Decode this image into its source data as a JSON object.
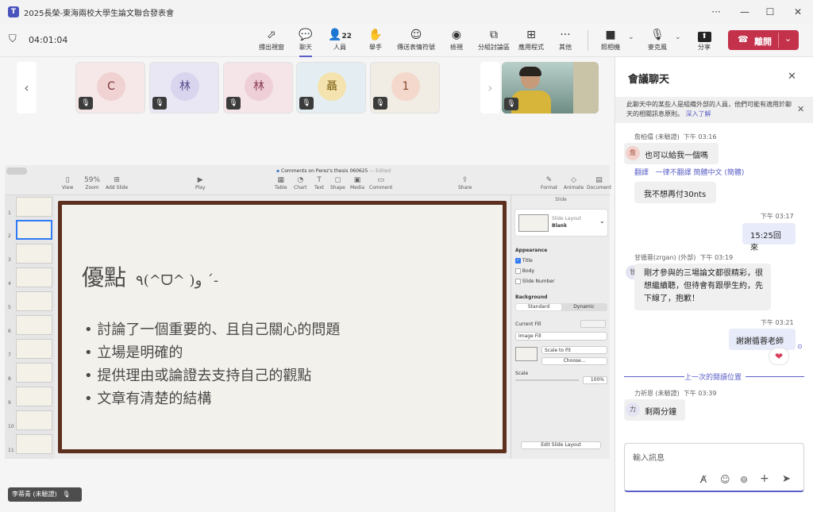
{
  "window": {
    "title": "2025長榮-東海兩校大學生論文聯合發表會",
    "more": "···",
    "minimize": "—",
    "maximize": "☐",
    "close": "✕"
  },
  "meeting": {
    "timer": "04:01:04"
  },
  "toolbar": {
    "items": [
      {
        "label": "撐出視窗",
        "icon": "⬀"
      },
      {
        "label": "聊天",
        "icon": "💬"
      },
      {
        "label": "人員",
        "icon": "👤",
        "count": "22"
      },
      {
        "label": "舉手",
        "icon": "✋"
      },
      {
        "label": "傳送表情符號",
        "icon": "☺"
      },
      {
        "label": "檢視",
        "icon": "◉"
      },
      {
        "label": "分組討論區",
        "icon": "⧉"
      },
      {
        "label": "應用程式",
        "icon": "⊞"
      },
      {
        "label": "其他",
        "icon": "···"
      },
      {
        "label": "照相機",
        "icon": "■"
      },
      {
        "label": "麥克風",
        "icon": "🎙"
      },
      {
        "label": "分享",
        "icon": "⬆"
      }
    ],
    "leave_label": "離開",
    "leave_color": "#c4314b"
  },
  "participants": [
    {
      "initial": "C",
      "bg": "#f5e3e3",
      "avbg": "#f1cfcf",
      "color": "#8a3a3a"
    },
    {
      "initial": "林",
      "bg": "#e6e4f3",
      "avbg": "#d7d3ee",
      "color": "#5a4d8e"
    },
    {
      "initial": "林",
      "bg": "#f4e2e6",
      "avbg": "#efcdd6",
      "color": "#8a3a52"
    },
    {
      "initial": "聶",
      "bg": "#e3eef2",
      "avbg": "#f4e2ad",
      "color": "#7a5c10"
    },
    {
      "initial": "1",
      "bg": "#f3ece3",
      "avbg": "#f3d6c9",
      "color": "#8a4a30"
    }
  ],
  "keynote": {
    "doc_title": "Comments on Perez's thesis 060625",
    "doc_status": "— Edited",
    "zoom": "59%",
    "tools_left": [
      "View",
      "Zoom",
      "Add Slide"
    ],
    "play": "Play",
    "tools_mid": [
      "Table",
      "Chart",
      "Text",
      "Shape",
      "Media",
      "Comment"
    ],
    "share": "Share",
    "tools_right": [
      "Format",
      "Animate",
      "Document"
    ],
    "slide_numbers": [
      "1",
      "2",
      "3",
      "4",
      "5",
      "6",
      "7",
      "8",
      "9",
      "10",
      "11"
    ],
    "slide": {
      "heading": "優點",
      "emoticon": "٩(^ᗜ^ )و ´-",
      "bullets": [
        "討論了一個重要的、且自己關心的問題",
        "立場是明確的",
        "提供理由或論證去支持自己的觀點",
        "文章有清楚的結構"
      ]
    },
    "inspector": {
      "header": "Slide",
      "layout_label": "Slide Layout",
      "layout_value": "Blank",
      "appearance": "Appearance",
      "opt_title": "Title",
      "opt_body": "Body",
      "opt_slide_number": "Slide Number",
      "background": "Background",
      "seg_standard": "Standard",
      "seg_dynamic": "Dynamic",
      "current_fill": "Current Fill",
      "fill_type": "Image Fill",
      "scale_to_fit": "Scale to Fit",
      "choose": "Choose...",
      "scale": "Scale",
      "scale_value": "100%",
      "edit_layout": "Edit Slide Layout"
    }
  },
  "presenter_tag": "李蒂青 (未驗證)",
  "chat": {
    "title": "會議聊天",
    "banner": "此聊天中的某些人是組織外部的人員，他們可能有適用於聊天的相關訊息原則。",
    "banner_link": "深入了解",
    "messages": [
      {
        "sender": "詹柏僖 (未驗證)",
        "time": "下午 03:16",
        "avatar": "詹",
        "text": "也可以給我一個嗎"
      },
      {
        "translate": "翻譯",
        "always_translate": "一律不翻譯 簡體中文 (簡體)",
        "text2": "我不想再付30nts"
      },
      {
        "time": "下午 03:17",
        "text": "15:25回來"
      },
      {
        "sender": "甘循蓉(zrgan) (外部)",
        "time": "下午 03:19",
        "avatar": "甘",
        "text": "剛才參與的三場論文都很精彩，很想繼續聽，但待會有跟學生約，先下線了，抱歉！"
      },
      {
        "time": "下午 03:21",
        "text": "謝謝循蓉老師",
        "reaction": "❤"
      },
      {
        "sender": "力祈恩 (未驗證)",
        "time": "下午 03:39",
        "avatar": "力",
        "text": "剩兩分鐘"
      }
    ],
    "last_read": "上一次的閱讀位置",
    "input_placeholder": "輸入訊息"
  }
}
